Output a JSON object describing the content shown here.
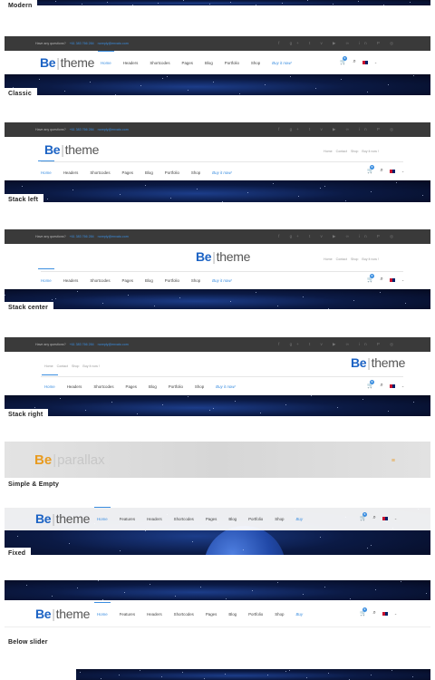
{
  "sections": {
    "modern": "Modern",
    "classic": "Classic",
    "stack_left": "Stack left",
    "stack_center": "Stack center",
    "stack_right": "Stack right",
    "simple": "Simple & Empty",
    "fixed": "Fixed",
    "below_slider": "Below slider"
  },
  "topbar": {
    "question": "Have any questions?",
    "phone": "+61 383 766 284",
    "email": "noreply@envato.com",
    "social": "f  g+  t  v  ▶  ∞  in  P  ◎"
  },
  "logo": {
    "be": "Be",
    "name": "theme",
    "parallax_name": "parallax"
  },
  "menu": {
    "home": "Home",
    "features": "Features",
    "headers": "Headers",
    "shortcodes": "Shortcodes",
    "pages": "Pages",
    "blog": "Blog",
    "portfolio": "Portfolio",
    "shop": "Shop",
    "buy": "Buy it now!",
    "buy_short": "Buy"
  },
  "top_links": {
    "home": "Home",
    "contact": "Contact",
    "shop": "Shop",
    "buy": "Buy it now !"
  },
  "cart_count": "0",
  "colors": {
    "accent": "#3b8ee0",
    "brand": "#1c63c4",
    "parallax_accent": "#e89b20"
  }
}
